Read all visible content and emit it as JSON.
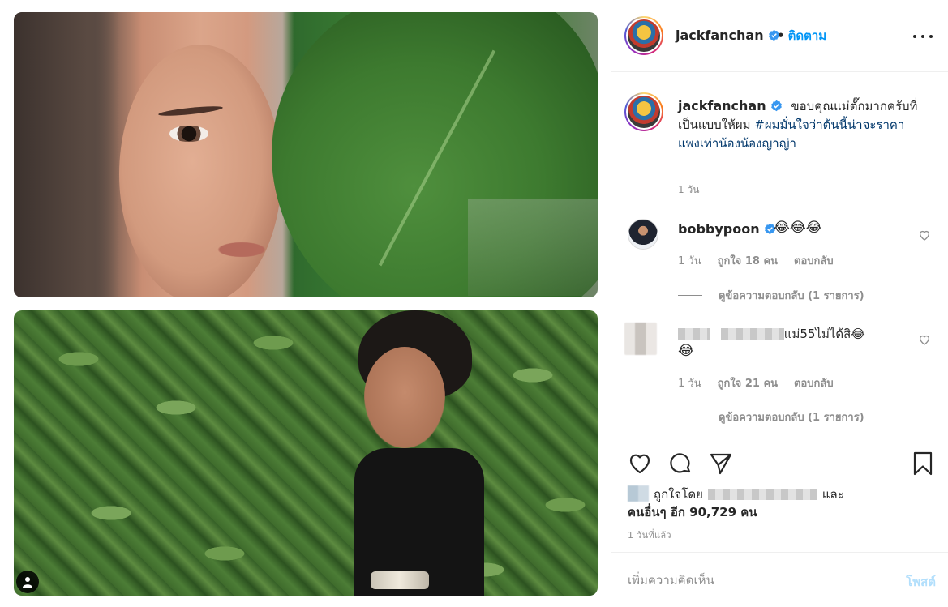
{
  "post": {
    "author": {
      "username": "jackfanchan",
      "verified": true,
      "follow_label": "ติดตาม",
      "dot": "•"
    },
    "caption": {
      "username": "jackfanchan",
      "text": "ขอบคุณแม่ตั๊กมากครับที่เป็นแบบให้ผม",
      "hashtag": "#ผมมั่นใจว่าต้นนี้น่าจะราคาแพงเท่าน้องน้องญาญ่า",
      "time": "1 วัน"
    },
    "comments": [
      {
        "username": "bobbypoon",
        "verified": true,
        "text": "😂😂😂",
        "time": "1 วัน",
        "likes": "ถูกใจ 18 คน",
        "reply_label": "ตอบกลับ",
        "view_replies": "ดูข้อความตอบกลับ (1 รายการ)"
      },
      {
        "username": "",
        "text": "แม่55ไม่ได้สิ😂",
        "text_line2": "😂",
        "time": "1 วัน",
        "likes": "ถูกใจ 21 คน",
        "reply_label": "ตอบกลับ",
        "view_replies": "ดูข้อความตอบกลับ (1 รายการ)"
      }
    ],
    "likes": {
      "prefix": "ถูกใจโดย",
      "and": "และ",
      "others": "คนอื่นๆ อีก 90,729 คน"
    },
    "date": "1 วันที่แล้ว",
    "add_comment": {
      "placeholder": "เพิ่มความคิดเห็น",
      "post_label": "โพสต์"
    }
  },
  "icons": {
    "more": "more-options-icon",
    "like": "heart-icon",
    "comment": "comment-icon",
    "share": "share-icon",
    "save": "bookmark-icon",
    "verified": "verified-badge-icon",
    "tag": "user-tag-icon"
  },
  "colors": {
    "link": "#0095f6",
    "hashtag": "#00376b",
    "muted": "#8e8e8e",
    "post_disabled": "#b2dffc"
  }
}
